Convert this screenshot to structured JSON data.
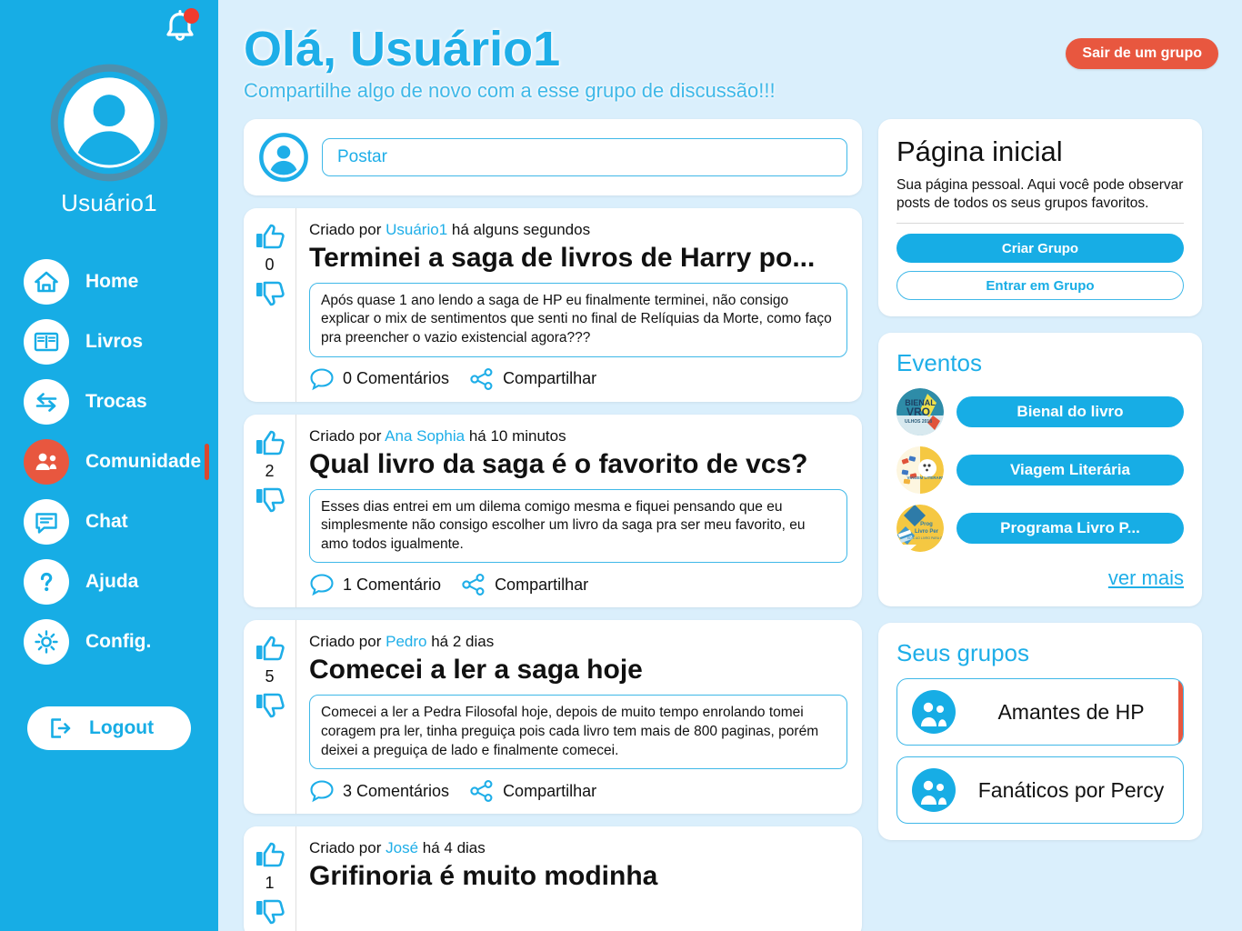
{
  "sidebar": {
    "notification_icon": "bell-icon",
    "has_notification": true,
    "avatar_icon": "user-avatar-icon",
    "user_name": "Usuário1",
    "nav_items": [
      {
        "label": "Home",
        "icon": "home-icon",
        "active": false
      },
      {
        "label": "Livros",
        "icon": "book-icon",
        "active": false
      },
      {
        "label": "Trocas",
        "icon": "exchange-icon",
        "active": false
      },
      {
        "label": "Comunidade",
        "icon": "community-icon",
        "active": true
      },
      {
        "label": "Chat",
        "icon": "chat-icon",
        "active": false
      },
      {
        "label": "Ajuda",
        "icon": "help-icon",
        "active": false
      },
      {
        "label": "Config.",
        "icon": "gear-icon",
        "active": false
      }
    ],
    "logout_label": "Logout",
    "logout_icon": "logout-icon"
  },
  "header": {
    "title": "Olá, Usuário1",
    "subtitle": "Compartilhe algo de novo com a esse grupo de discussão!!!",
    "leave_group_label": "Sair de um grupo"
  },
  "composer": {
    "avatar_icon": "user-avatar-icon",
    "placeholder": "Postar",
    "value": ""
  },
  "feed": {
    "created_by_prefix": "Criado por",
    "share_label": "Compartilhar",
    "posts": [
      {
        "author": "Usuário1",
        "time": "há alguns segundos",
        "title": "Terminei a saga de livros de Harry po...",
        "text": "Após quase 1 ano lendo a saga de HP eu finalmente terminei, não consigo explicar o mix de sentimentos que senti no final de Relíquias da Morte, como faço pra preencher o vazio existencial agora???",
        "votes": "0",
        "comments": "0 Comentários"
      },
      {
        "author": "Ana Sophia",
        "time": "há 10 minutos",
        "title": "Qual livro da saga é o favorito de vcs?",
        "text": "Esses dias entrei em um dilema comigo mesma e fiquei pensando que eu simplesmente não consigo escolher um livro da saga pra ser meu favorito, eu amo todos igualmente.",
        "votes": "2",
        "comments": "1 Comentário"
      },
      {
        "author": "Pedro",
        "time": "há 2 dias",
        "title": "Comecei a ler a saga hoje",
        "text": "Comecei a ler a Pedra Filosofal hoje, depois de muito tempo enrolando tomei coragem pra ler, tinha preguiça pois cada livro tem mais de 800 paginas, porém deixei a preguiça de lado e finalmente comecei.",
        "votes": "5",
        "comments": "3 Comentários"
      },
      {
        "author": "José",
        "time": "há 4 dias",
        "title": "Grifinoria é muito modinha",
        "text": "",
        "votes": "1",
        "comments": ""
      }
    ]
  },
  "home_card": {
    "title": "Página inicial",
    "description": "Sua página pessoal. Aqui você pode observar posts de todos os seus grupos favoritos.",
    "create_group_label": "Criar Grupo",
    "join_group_label": "Entrar em Grupo"
  },
  "events_card": {
    "title": "Eventos",
    "see_more_label": "ver mais",
    "events": [
      {
        "label": "Bienal do livro",
        "thumb": "bienal-do-livro-thumb"
      },
      {
        "label": "Viagem Literária",
        "thumb": "viagem-literaria-thumb"
      },
      {
        "label": "Programa Livro P...",
        "thumb": "programa-livro-thumb"
      }
    ]
  },
  "groups_card": {
    "title": "Seus grupos",
    "groups": [
      {
        "name": "Amantes de HP",
        "icon": "group-people-icon",
        "active": true
      },
      {
        "name": "Fanáticos por Percy",
        "icon": "group-people-icon",
        "active": false
      }
    ]
  },
  "colors": {
    "brand_blue": "#17ade5",
    "accent_orange": "#e8573f",
    "page_background": "#daeffc",
    "card_white": "#ffffff",
    "notification_red": "#ef3b2d"
  }
}
